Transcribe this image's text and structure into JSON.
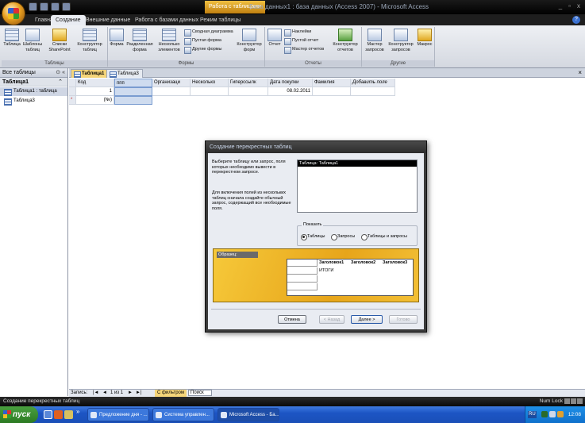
{
  "titlebar": {
    "context_tab": "Работа с таблицами",
    "app_title": "База данных1 : база данных (Access 2007) - Microsoft Access",
    "controls": [
      "_",
      "▫",
      "x"
    ]
  },
  "ribbon_tabs": [
    {
      "label": "Главная"
    },
    {
      "label": "Создание"
    },
    {
      "label": "Внешние данные"
    },
    {
      "label": "Работа с базами данных"
    },
    {
      "label": "Режим таблицы"
    }
  ],
  "ribbon": {
    "groups": {
      "tables": "Таблицы",
      "forms": "Формы",
      "reports": "Отчеты",
      "other": "Другие"
    },
    "buttons": {
      "table": "Таблица",
      "table_templates": "Шаблоны таблиц",
      "sharepoint_lists": "Списки SharePoint",
      "table_designer": "Конструктор таблиц",
      "form": "Форма",
      "split_form": "Разделенная форма",
      "multiple_items": "Несколько элементов",
      "pivot_chart": "Сводная диаграмма",
      "blank_form": "Пустая форма",
      "more_forms": "Другие формы",
      "form_designer": "Конструктор форм",
      "report": "Отчет",
      "labels": "Наклейки",
      "blank_report": "Пустой отчет",
      "report_wizard": "Мастер отчетов",
      "report_designer": "Конструктор отчетов",
      "query_wizard": "Мастер запросов",
      "query_designer": "Конструктор запросов",
      "macro": "Макрос"
    }
  },
  "nav": {
    "header": "Все таблицы",
    "header_ctrl": "⊙ «",
    "group": "Таблица1",
    "group_chevron": "⌃",
    "items": [
      {
        "label": "Таблица1 : таблица"
      },
      {
        "label": "Таблица3"
      }
    ]
  },
  "doc": {
    "tabs": [
      {
        "label": "Таблица1"
      },
      {
        "label": "Таблица3"
      }
    ],
    "close": "×",
    "grid": {
      "headers": [
        "Код",
        "ппп",
        "Организаци",
        "Несколько",
        "Гиперссылк",
        "Дата покупки",
        "Фамилия",
        "Добавить поле"
      ],
      "row1": [
        "1",
        "",
        "",
        "",
        "",
        "08.02.2011",
        "",
        ""
      ],
      "new_row_marker": "*",
      "new_row_code": "(№)"
    },
    "recbar": {
      "label": "Запись:",
      "nav_first": "|◄",
      "nav_prev": "◄",
      "position": "1 из 1",
      "nav_next": "►",
      "nav_last": "►|",
      "filter": "С фильтром",
      "search": "Поиск"
    }
  },
  "statusbar": {
    "text": "Создание перекрестных таблиц",
    "numlock": "Num Lock"
  },
  "taskbar": {
    "start": "пуск",
    "more": "»",
    "tasks": [
      {
        "label": "Предложение дня - ..."
      },
      {
        "label": "Система управлен..."
      },
      {
        "label": "Microsoft Access - Ба..."
      }
    ],
    "clock": "12:08",
    "lang": "RU"
  },
  "dialog": {
    "title": "Создание перекрестных таблиц",
    "desc1": "Выберите таблицу или запрос, поля которых необходимо вывести в перекрестном запросе.",
    "desc2": "Для включения полей из нескольких таблиц сначала создайте обычный запрос, содержащий все необходимые поля.",
    "list_items": [
      "Таблица: Таблица1"
    ],
    "show_legend": "Показать",
    "radios": [
      {
        "label": "Таблицы",
        "checked": true
      },
      {
        "label": "Запросы",
        "checked": false
      },
      {
        "label": "Таблицы и запросы",
        "checked": false
      }
    ],
    "sample_label": "Образец:",
    "sample_headers": [
      "Заголовок1",
      "Заголовок2",
      "Заголовок3"
    ],
    "sample_total": "ИТОГИ",
    "buttons": {
      "cancel": "Отмена",
      "back": "< Назад",
      "next": "Далее >",
      "finish": "Готово"
    }
  }
}
